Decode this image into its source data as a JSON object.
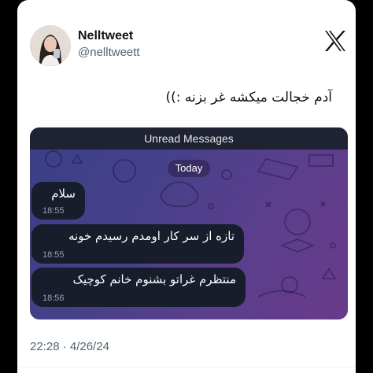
{
  "author": {
    "name": "Nelltweet",
    "handle": "@nelltweett"
  },
  "tweet": {
    "text": "آدم خجالت میکشه غر بزنه :))",
    "timestamp": "22:28 · 4/26/24"
  },
  "chat": {
    "unread_label": "Unread Messages",
    "date_label": "Today",
    "messages": [
      {
        "text": "سلام",
        "time": "18:55"
      },
      {
        "text": "تازه از سر کار اومدم رسیدم خونه",
        "time": "18:55"
      },
      {
        "text": "منتظرم غراتو بشنوم خانم کوچیک",
        "time": "18:56"
      }
    ]
  },
  "icons": {
    "platform_logo": "x-logo-icon"
  },
  "colors": {
    "card_bg": "#ffffff",
    "text_primary": "#0f1419",
    "text_secondary": "#536471",
    "chat_bubble": "#181d2c",
    "chat_bg_start": "#3a3f86",
    "chat_bg_end": "#6a3a8a"
  }
}
